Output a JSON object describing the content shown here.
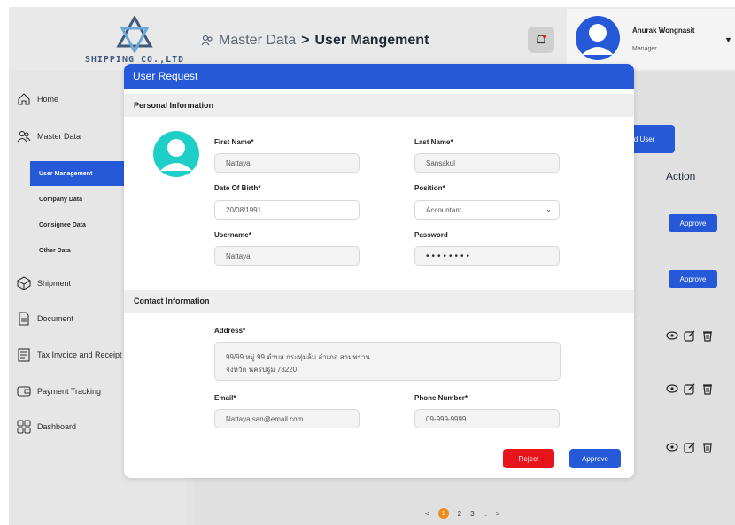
{
  "company": {
    "name": "SHIPPING CO.,LTD"
  },
  "breadcrumb": {
    "section": "Master Data",
    "separator": ">",
    "page": "User Mangement"
  },
  "user": {
    "name": "Anurak Wongnasit",
    "role": "Manager"
  },
  "sidebar": {
    "items": [
      {
        "label": "Home",
        "icon": "home-icon"
      },
      {
        "label": "Master Data",
        "icon": "users-icon"
      },
      {
        "label": "Shipment",
        "icon": "box-icon"
      },
      {
        "label": "Document",
        "icon": "document-icon"
      },
      {
        "label": "Tax Invoice and Receipt",
        "icon": "receipt-icon"
      },
      {
        "label": "Payment Tracking",
        "icon": "wallet-icon"
      },
      {
        "label": "Dashboard",
        "icon": "grid-icon"
      }
    ],
    "sub_items": [
      "User Management",
      "Company Data",
      "Consignee Data",
      "Other Data"
    ]
  },
  "background": {
    "add_user_label": "Add User",
    "action_header": "Action",
    "row_approve_label": "Approve",
    "pager": {
      "prev": "<",
      "pages": [
        "1",
        "2",
        "3",
        ".."
      ],
      "next": ">"
    }
  },
  "modal": {
    "title": "User Request",
    "personal_section": "Personal Information",
    "contact_section": "Contact Information",
    "fields": {
      "first_name": {
        "label": "First Name*",
        "value": "Nattaya"
      },
      "last_name": {
        "label": "Last Name*",
        "value": "Sansakul"
      },
      "dob": {
        "label": "Date Of Birth*",
        "value": "20/08/1991"
      },
      "position": {
        "label": "Position*",
        "value": "Accountant"
      },
      "username": {
        "label": "Username*",
        "value": "Nattaya"
      },
      "password": {
        "label": "Password",
        "value": "••••••••"
      },
      "address": {
        "label": "Address*",
        "line1": "99/99 หมู่ 99 ตำบล กระทุ่มล้ม อำเภอ สามพราน",
        "line2": "จังหวัด นครปฐม 73220"
      },
      "email": {
        "label": "Email*",
        "value": "Nattaya.san@email.com"
      },
      "phone": {
        "label": "Phone Number*",
        "value": "09-999-9999"
      }
    },
    "reject_label": "Reject",
    "approve_label": "Approve"
  },
  "colors": {
    "primary": "#2659d8",
    "danger": "#e8141b",
    "avatar_teal": "#1ecfc8",
    "pager_active": "#f08a1a"
  }
}
